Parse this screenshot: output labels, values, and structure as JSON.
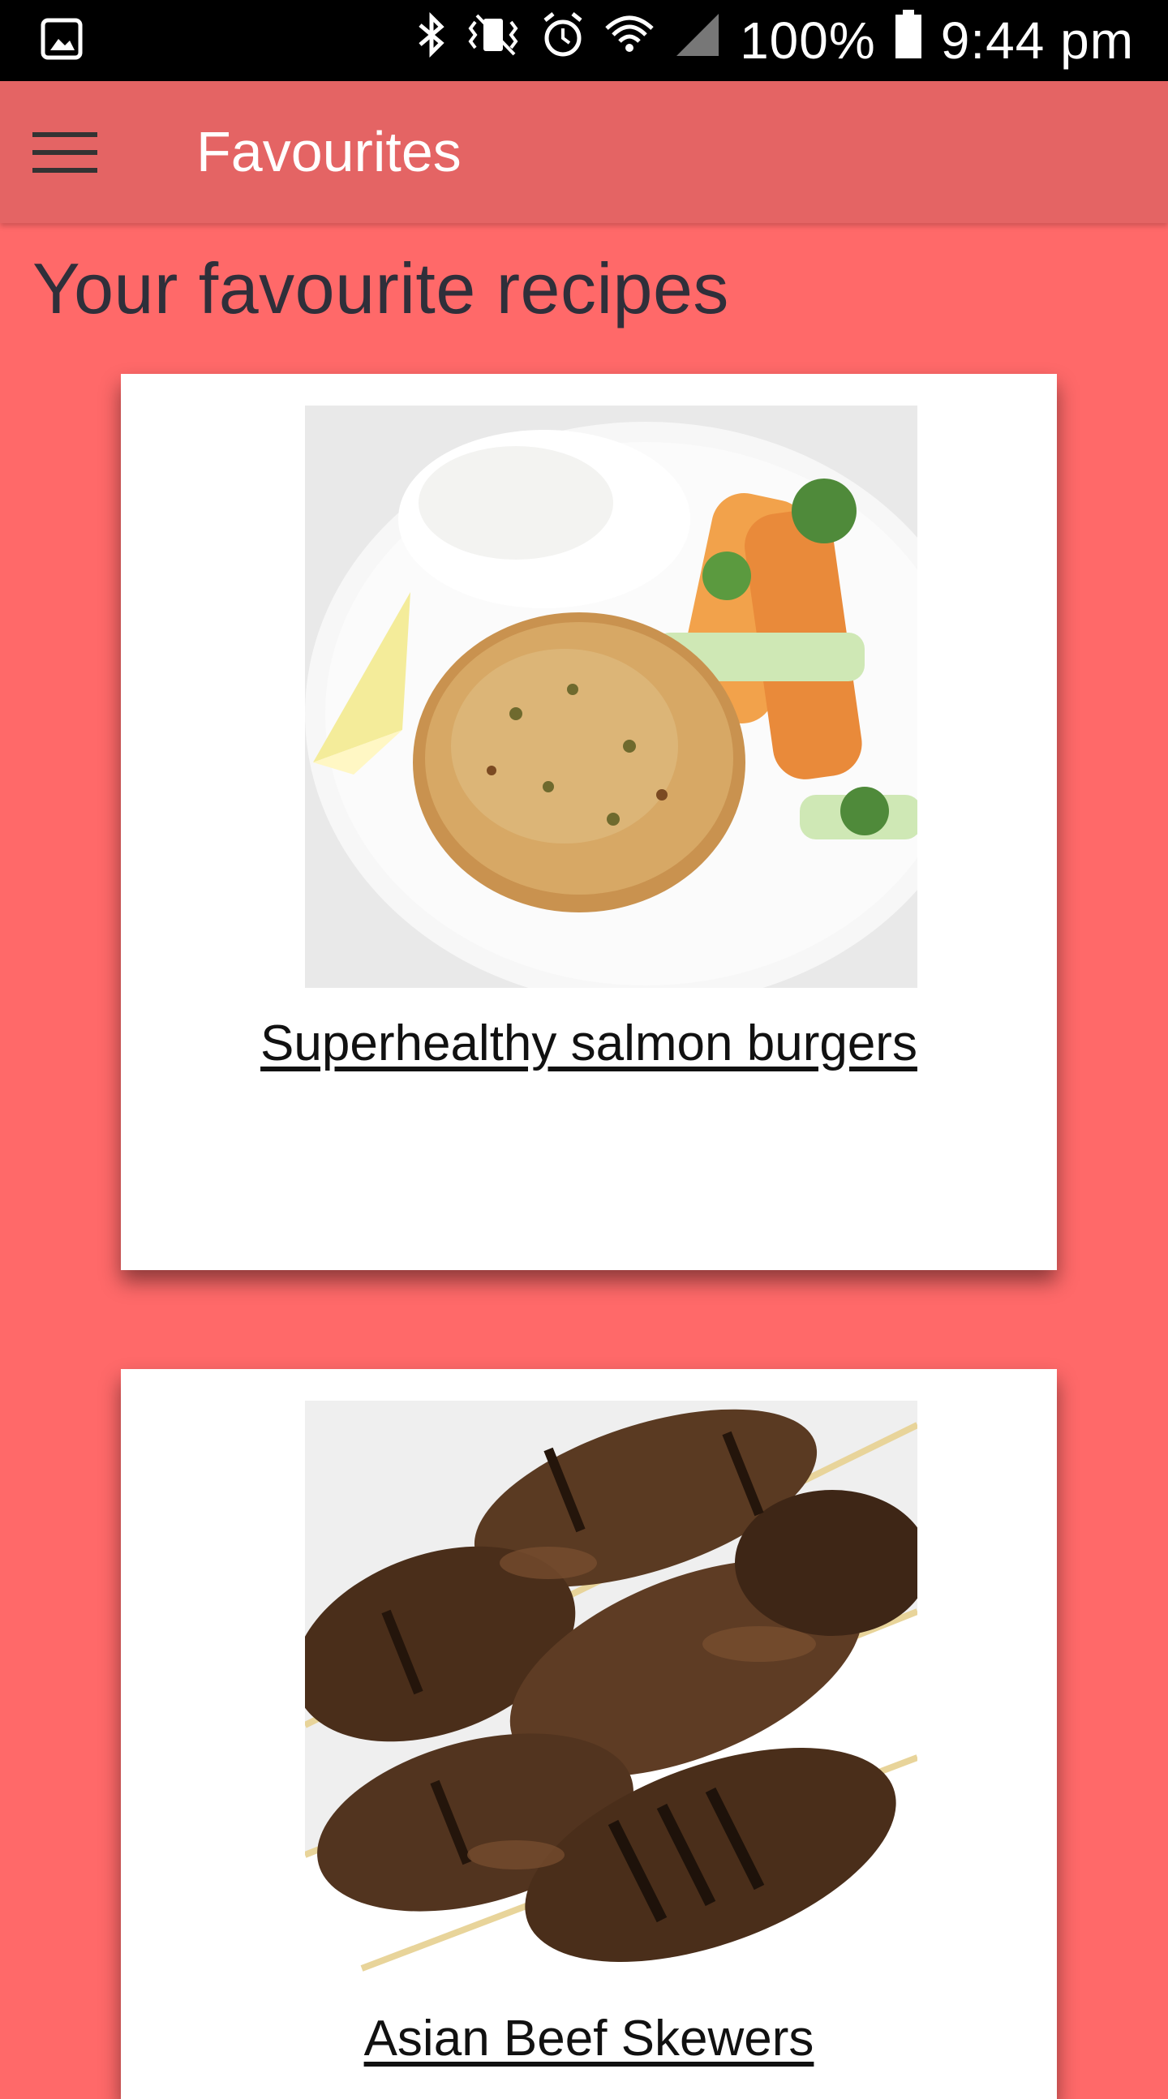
{
  "status_bar": {
    "battery": "100%",
    "time": "9:44 pm",
    "icons": [
      "gallery-icon",
      "bluetooth-icon",
      "vibrate-icon",
      "alarm-icon",
      "wifi-icon",
      "signal-icon",
      "battery-icon"
    ]
  },
  "app_bar": {
    "title": "Favourites",
    "menu_icon": "hamburger-menu-icon"
  },
  "main": {
    "heading": "Your favourite recipes",
    "recipes": [
      {
        "title": "Superhealthy salmon burgers",
        "image": "salmon-burger-photo"
      },
      {
        "title": "Asian Beef Skewers",
        "image": "beef-skewers-photo"
      }
    ]
  },
  "colors": {
    "background": "#ff6969",
    "app_bar": "#e46464",
    "status_bar": "#000000",
    "card": "#ffffff"
  }
}
